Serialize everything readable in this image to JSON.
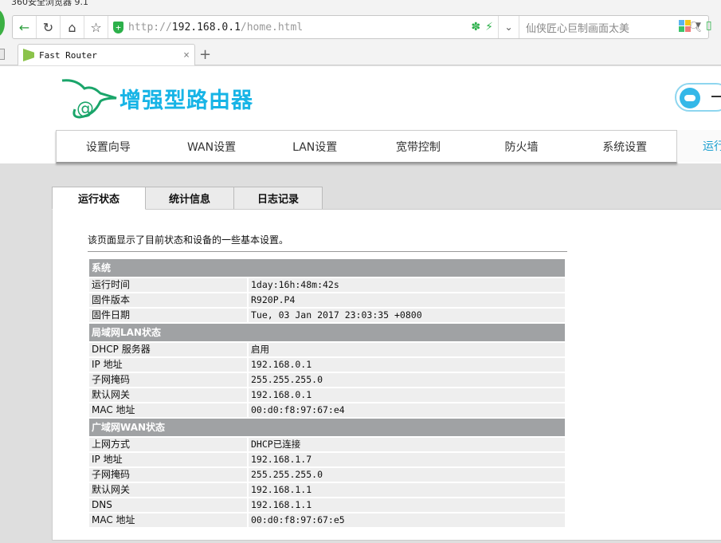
{
  "browser": {
    "app_title": "360安全浏览器 9.1",
    "url_prefix": "http://",
    "url_host": "192.168.0.1",
    "url_path": "/home.html",
    "search_placeholder": "仙侠匠心巨制画面太美",
    "tab_title": "Fast Router",
    "tab_close": "×",
    "new_tab": "+",
    "accent": "#2cb04a"
  },
  "header": {
    "logo_text": "增强型路由器",
    "brand_color": "#17b4e6"
  },
  "nav": {
    "items": [
      "设置向导",
      "WAN设置",
      "LAN设置",
      "宽带控制",
      "防火墙",
      "系统设置"
    ],
    "active_partial": "运行"
  },
  "page_tabs": [
    {
      "label": "运行状态",
      "active": true
    },
    {
      "label": "统计信息",
      "active": false
    },
    {
      "label": "日志记录",
      "active": false
    }
  ],
  "description": "该页面显示了目前状态和设备的一些基本设置。",
  "sections": [
    {
      "title": "系统",
      "rows": [
        {
          "key": "运行时间",
          "value": "1day:16h:48m:42s"
        },
        {
          "key": "固件版本",
          "value": "R920P.P4"
        },
        {
          "key": "固件日期",
          "value": "Tue, 03 Jan 2017 23:03:35 +0800"
        }
      ]
    },
    {
      "title": "局域网LAN状态",
      "rows": [
        {
          "key": "DHCP 服务器",
          "value": "启用"
        },
        {
          "key": "IP 地址",
          "value": "192.168.0.1"
        },
        {
          "key": "子网掩码",
          "value": "255.255.255.0"
        },
        {
          "key": "默认网关",
          "value": "192.168.0.1"
        },
        {
          "key": "MAC 地址",
          "value": "00:d0:f8:97:67:e4"
        }
      ]
    },
    {
      "title": "广域网WAN状态",
      "rows": [
        {
          "key": "上网方式",
          "value": "DHCP已连接"
        },
        {
          "key": "IP 地址",
          "value": "192.168.1.7"
        },
        {
          "key": "子网掩码",
          "value": "255.255.255.0"
        },
        {
          "key": "默认网关",
          "value": "192.168.1.1"
        },
        {
          "key": "DNS",
          "value": "192.168.1.1"
        },
        {
          "key": "MAC 地址",
          "value": "00:d0:f8:97:67:e5"
        }
      ]
    }
  ]
}
